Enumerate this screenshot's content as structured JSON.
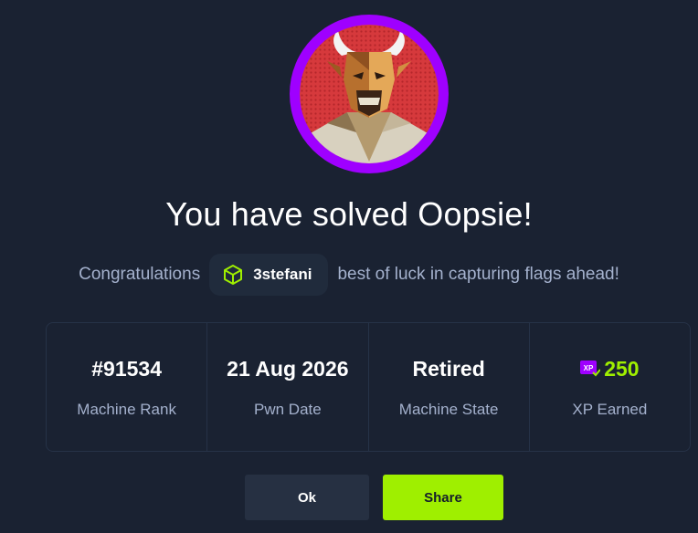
{
  "modal": {
    "title": "You have solved Oopsie!",
    "congrats_prefix": "Congratulations",
    "username": "3stefani",
    "congrats_suffix": "best of luck in capturing flags ahead!",
    "user_icon": "cube-icon",
    "avatar_icon": "bull-machine-avatar"
  },
  "stats": [
    {
      "value": "#91534",
      "label": "Machine Rank"
    },
    {
      "value": "21 Aug 2026",
      "label": "Pwn Date"
    },
    {
      "value": "Retired",
      "label": "Machine State"
    },
    {
      "value": "250",
      "label": "XP Earned",
      "badge": "XP"
    }
  ],
  "buttons": {
    "ok": "Ok",
    "share": "Share"
  },
  "colors": {
    "background": "#1a2232",
    "accent": "#9fef00",
    "ring": "#9f00ff",
    "muted_text": "#a4b1cd"
  }
}
